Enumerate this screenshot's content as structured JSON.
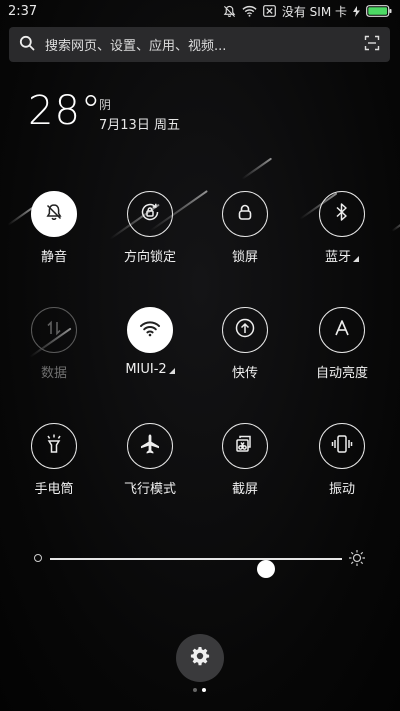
{
  "status_bar": {
    "time": "2:37",
    "carrier": "没有 SIM 卡",
    "icons": [
      "mute-icon",
      "wifi-icon",
      "no-sim-icon",
      "charging-icon",
      "battery-icon"
    ],
    "battery_level": 1.0,
    "battery_color": "#4cd964"
  },
  "search": {
    "placeholder": "搜索网页、设置、应用、视频..."
  },
  "weather": {
    "temperature": "28°",
    "condition": "阴",
    "date": "7月13日 周五"
  },
  "toggles": [
    {
      "label": "静音",
      "icon": "bell-off-icon",
      "state": "on"
    },
    {
      "label": "方向锁定",
      "icon": "rotation-lock-icon",
      "state": "off"
    },
    {
      "label": "锁屏",
      "icon": "lock-icon",
      "state": "off"
    },
    {
      "label": "蓝牙",
      "icon": "bluetooth-icon",
      "state": "off",
      "has_menu": true
    },
    {
      "label": "数据",
      "icon": "mobile-data-icon",
      "state": "disabled"
    },
    {
      "label": "MIUI-2",
      "icon": "wifi-icon",
      "state": "on",
      "has_menu": true
    },
    {
      "label": "快传",
      "icon": "quick-transfer-icon",
      "state": "off"
    },
    {
      "label": "自动亮度",
      "icon": "auto-brightness-icon",
      "state": "off"
    },
    {
      "label": "手电筒",
      "icon": "flashlight-icon",
      "state": "off"
    },
    {
      "label": "飞行模式",
      "icon": "airplane-icon",
      "state": "off"
    },
    {
      "label": "截屏",
      "icon": "screenshot-icon",
      "state": "off"
    },
    {
      "label": "振动",
      "icon": "vibrate-icon",
      "state": "off"
    }
  ],
  "brightness": {
    "level": 0.74,
    "low_icon": "brightness-low-icon",
    "high_icon": "brightness-high-icon"
  },
  "settings": {
    "icon": "gear-icon"
  },
  "pager": {
    "pages": 2,
    "current": 2
  },
  "colors": {
    "background": "#0b0b0c",
    "toggle_on": "#ffffff",
    "toggle_border": "#e6e6e6",
    "disabled": "#5a5a5a"
  }
}
